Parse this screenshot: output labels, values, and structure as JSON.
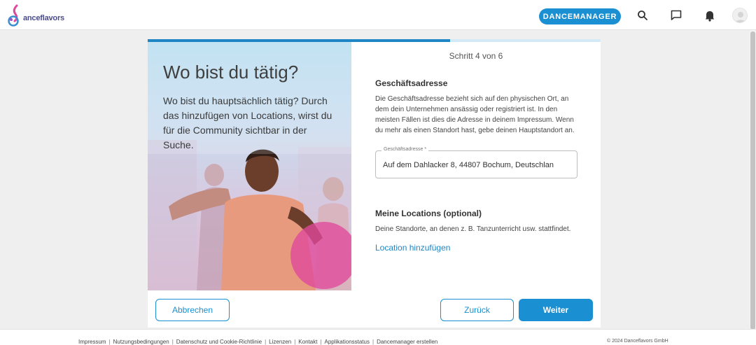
{
  "header": {
    "logo_text": "anceflavors",
    "dancemanager_label": "DANCEMANAGER"
  },
  "icons": {
    "search": "search-icon",
    "chat": "chat-icon",
    "bell": "bell-icon",
    "avatar": "user-avatar-icon"
  },
  "progress": {
    "step_label": "Schritt 4 von 6",
    "value": 0.667
  },
  "hero": {
    "title": "Wo bist du tätig?",
    "text": "Wo bist du hauptsächlich tätig? Durch das hinzufügen von Locations, wirst du für die Community sichtbar in der Suche."
  },
  "business": {
    "title": "Geschäftsadresse",
    "description": "Die Geschäftsadresse bezieht sich auf den physischen Ort, an dem dein Unternehmen ansässig oder registriert ist. In den meisten Fällen ist dies die Adresse in deinem Impressum. Wenn du mehr als einen Standort hast, gebe deinen Hauptstandort an.",
    "field_label": "Geschäftsadresse *",
    "field_value": "Auf dem Dahlacker 8, 44807 Bochum, Deutschlan"
  },
  "locations": {
    "title": "Meine Locations (optional)",
    "description": "Deine Standorte, an denen z. B. Tanzunterricht usw. stattfindet.",
    "add_label": "Location hinzufügen"
  },
  "buttons": {
    "cancel": "Abbrechen",
    "back": "Zurück",
    "next": "Weiter"
  },
  "footer": {
    "links": [
      "Impressum",
      "Nutzungsbedingungen",
      "Datenschutz und Cookie-Richtlinie",
      "Lizenzen",
      "Kontakt",
      "Applikationsstatus",
      "Dancemanager erstellen"
    ],
    "separator": "|",
    "copyright": "© 2024 Danceflavors GmbH"
  },
  "colors": {
    "primary": "#1a8fd2",
    "progress_track": "#d4e9f6",
    "accent_pink": "#e0489b"
  }
}
